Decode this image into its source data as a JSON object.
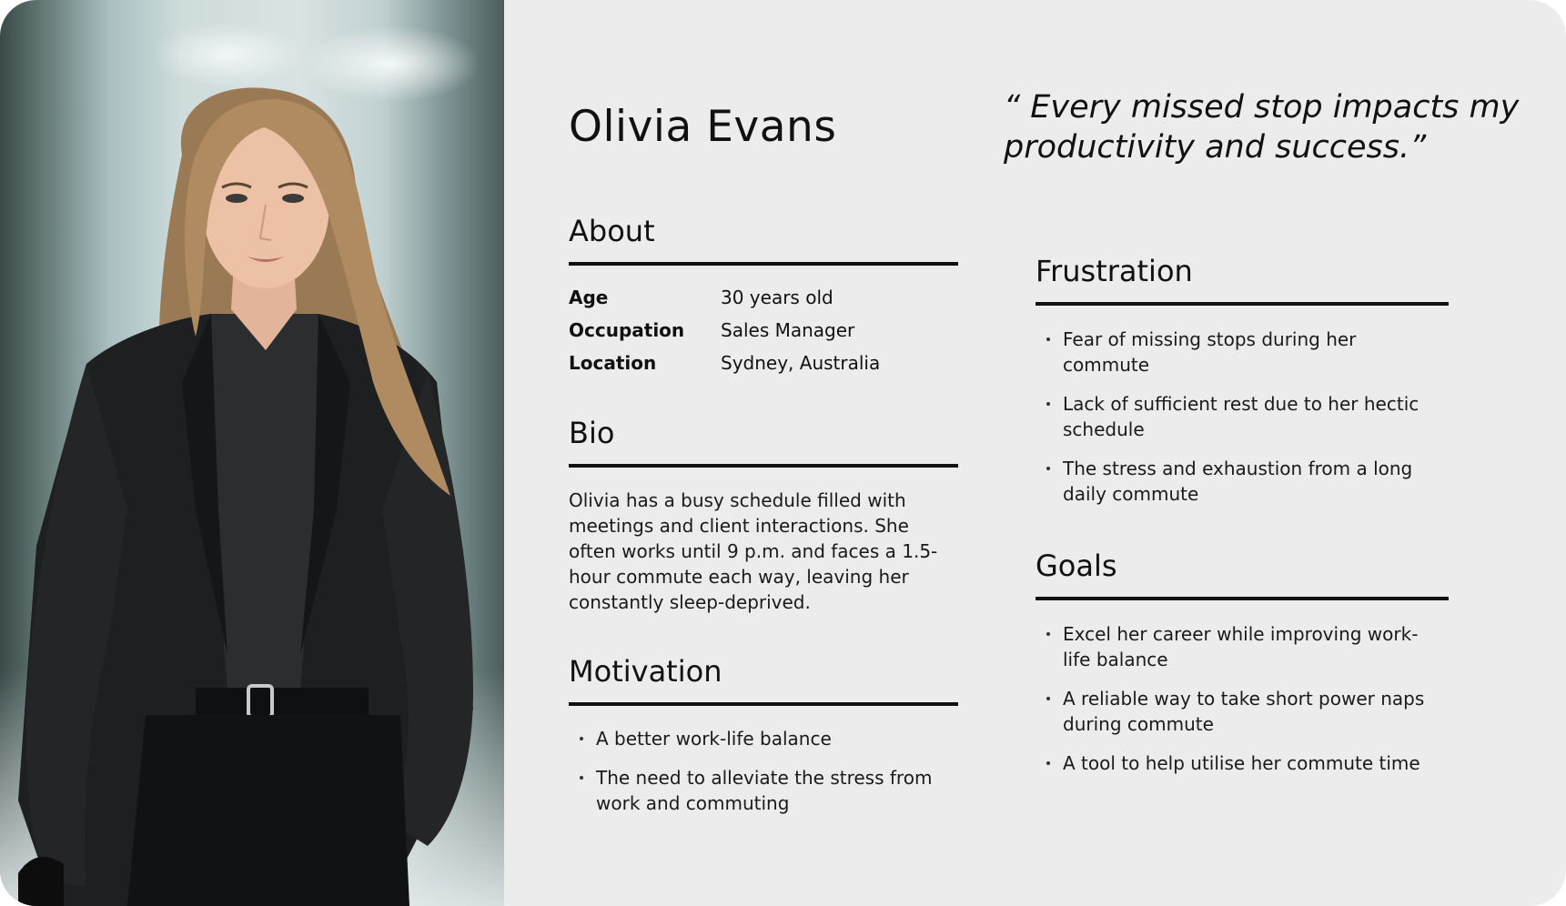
{
  "persona": {
    "name": "Olivia Evans",
    "quote": "“ Every missed stop impacts my productivity and success.”"
  },
  "about": {
    "title": "About",
    "rows": [
      {
        "label": "Age",
        "value": "30 years old"
      },
      {
        "label": "Occupation",
        "value": "Sales Manager"
      },
      {
        "label": "Location",
        "value": "Sydney, Australia"
      }
    ]
  },
  "bio": {
    "title": "Bio",
    "text": "Olivia has a busy schedule filled with meetings and client interactions. She often works until 9 p.m. and faces a 1.5-hour commute each way, leaving her constantly sleep-deprived."
  },
  "motivation": {
    "title": "Motivation",
    "items": [
      "A better work-life balance",
      "The need to alleviate the stress from work and commuting"
    ]
  },
  "frustration": {
    "title": "Frustration",
    "items": [
      "Fear of missing stops during her commute",
      "Lack of sufficient rest due to her hectic schedule",
      "The stress and exhaustion from a long daily commute"
    ]
  },
  "goals": {
    "title": "Goals",
    "items": [
      "Excel her career while improving work-life balance",
      "A reliable way to take short power naps during commute",
      "A tool to help utilise her commute time"
    ]
  },
  "colors": {
    "background": "#ececec",
    "text": "#111111",
    "rule": "#111111"
  }
}
